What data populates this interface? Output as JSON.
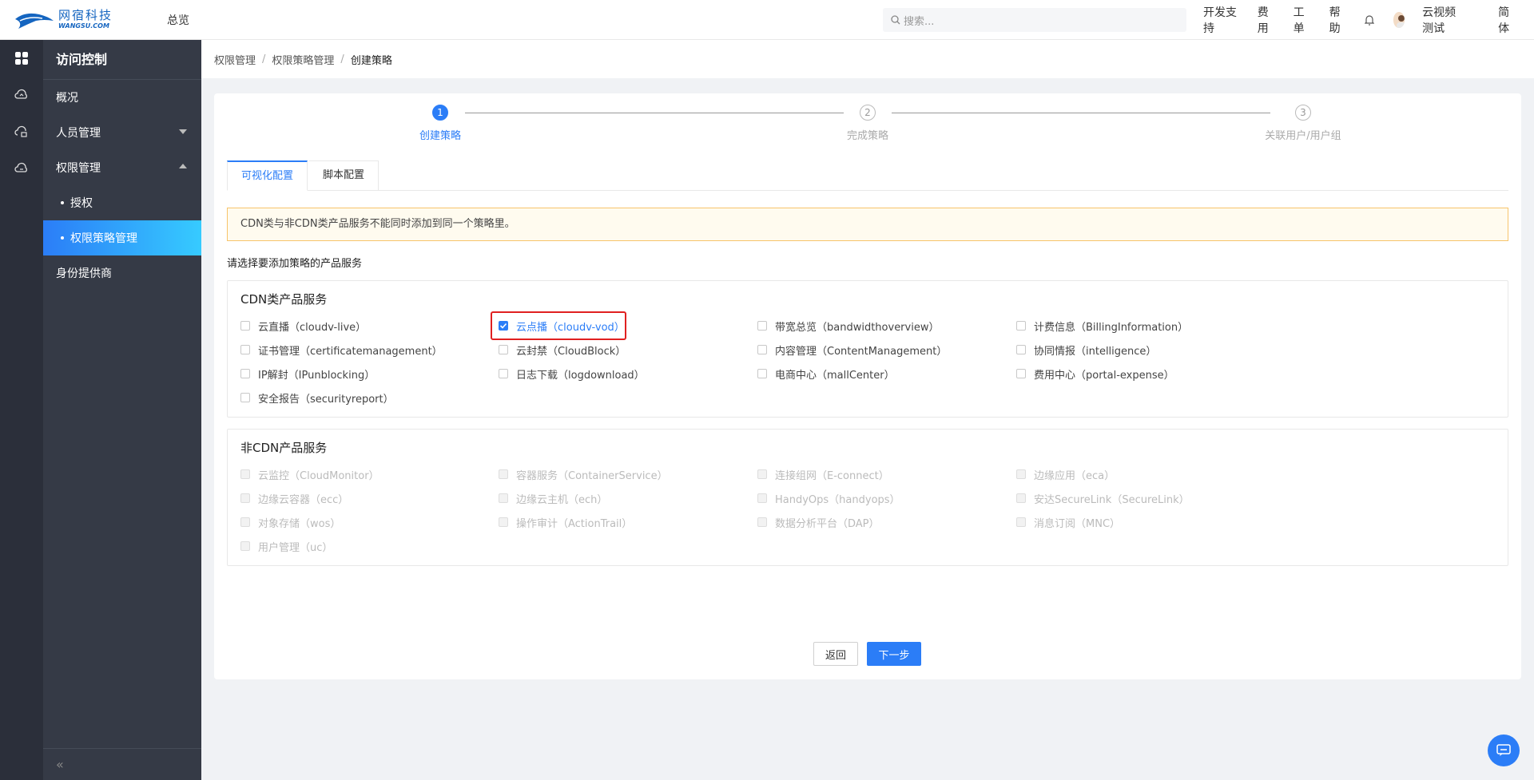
{
  "logo": {
    "cn": "网宿科技",
    "en": "WANGSU.COM"
  },
  "top_nav": {
    "overview": "总览",
    "search_placeholder": "搜索...",
    "items": [
      "开发支持",
      "费用",
      "工单",
      "帮助"
    ],
    "user": "云视频测试",
    "lang": "简体"
  },
  "sidebar": {
    "title": "访问控制",
    "items": [
      {
        "label": "概况"
      },
      {
        "label": "人员管理"
      },
      {
        "label": "权限管理"
      },
      {
        "label": "授权"
      },
      {
        "label": "权限策略管理"
      },
      {
        "label": "身份提供商"
      }
    ],
    "collapse": "«"
  },
  "breadcrumb": [
    "权限管理",
    "权限策略管理",
    "创建策略"
  ],
  "steps": [
    {
      "num": "1",
      "label": "创建策略"
    },
    {
      "num": "2",
      "label": "完成策略"
    },
    {
      "num": "3",
      "label": "关联用户/用户组"
    }
  ],
  "tabs": [
    "可视化配置",
    "脚本配置"
  ],
  "notice": "CDN类与非CDN类产品服务不能同时添加到同一个策略里。",
  "prompt": "请选择要添加策略的产品服务",
  "cdn_group": {
    "title": "CDN类产品服务",
    "items": [
      {
        "label": "云直播（cloudv-live）",
        "checked": false
      },
      {
        "label": "云点播（cloudv-vod）",
        "checked": true
      },
      {
        "label": "带宽总览（bandwidthoverview）",
        "checked": false
      },
      {
        "label": "计费信息（BillingInformation）",
        "checked": false
      },
      {
        "label": "证书管理（certificatemanagement）",
        "checked": false
      },
      {
        "label": "云封禁（CloudBlock）",
        "checked": false
      },
      {
        "label": "内容管理（ContentManagement）",
        "checked": false
      },
      {
        "label": "协同情报（intelligence）",
        "checked": false
      },
      {
        "label": "IP解封（IPunblocking）",
        "checked": false
      },
      {
        "label": "日志下载（logdownload）",
        "checked": false
      },
      {
        "label": "电商中心（mallCenter）",
        "checked": false
      },
      {
        "label": "费用中心（portal-expense）",
        "checked": false
      },
      {
        "label": "安全报告（securityreport）",
        "checked": false
      }
    ]
  },
  "noncdn_group": {
    "title": "非CDN产品服务",
    "items": [
      {
        "label": "云监控（CloudMonitor）"
      },
      {
        "label": "容器服务（ContainerService）"
      },
      {
        "label": "连接组网（E-connect）"
      },
      {
        "label": "边缘应用（eca）"
      },
      {
        "label": "边缘云容器（ecc）"
      },
      {
        "label": "边缘云主机（ech）"
      },
      {
        "label": "HandyOps（handyops）"
      },
      {
        "label": "安达SecureLink（SecureLink）"
      },
      {
        "label": "对象存储（wos）"
      },
      {
        "label": "操作审计（ActionTrail）"
      },
      {
        "label": "数据分析平台（DAP）"
      },
      {
        "label": "消息订阅（MNC）"
      },
      {
        "label": "用户管理（uc）"
      }
    ]
  },
  "buttons": {
    "back": "返回",
    "next": "下一步"
  },
  "colors": {
    "accent": "#2b7df7",
    "sidebar_bg": "#353a46",
    "highlight": "#e02020"
  }
}
